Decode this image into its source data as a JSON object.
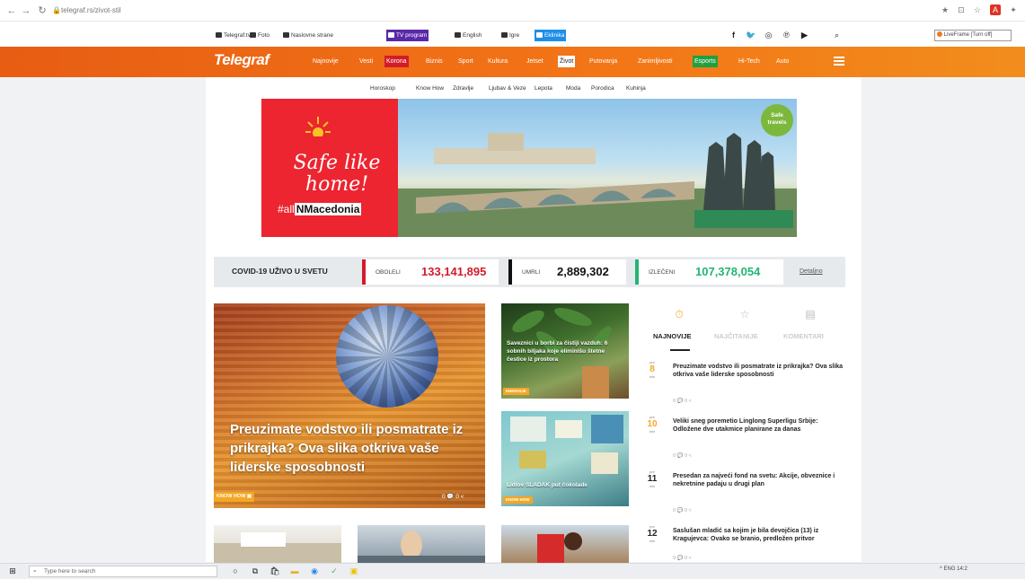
{
  "browser": {
    "url": "telegraf.rs/zivot-stil",
    "back": "←",
    "forward": "→",
    "reload": "↻"
  },
  "top_links": [
    {
      "label": "Telegraf.tv",
      "style": "plain"
    },
    {
      "label": "Foto",
      "style": "plain"
    },
    {
      "label": "Naslovne strane",
      "style": "plain"
    },
    {
      "label": "TV program",
      "style": "purple"
    },
    {
      "label": "English",
      "style": "plain"
    },
    {
      "label": "Igre",
      "style": "plain"
    },
    {
      "label": "Eklinika",
      "style": "blue"
    }
  ],
  "social": [
    "f",
    "t",
    "i",
    "p",
    "y"
  ],
  "extension": {
    "label": "LiveFrame [Turn off]"
  },
  "nav": {
    "logo": "Telegraf",
    "items": [
      {
        "label": "Najnovije",
        "style": "plain"
      },
      {
        "label": "Vesti",
        "style": "plain"
      },
      {
        "label": "Korona",
        "style": "red"
      },
      {
        "label": "Biznis",
        "style": "plain"
      },
      {
        "label": "Sport",
        "style": "plain"
      },
      {
        "label": "Kultura",
        "style": "plain"
      },
      {
        "label": "Jetset",
        "style": "plain"
      },
      {
        "label": "Život",
        "style": "white"
      },
      {
        "label": "Putovanja",
        "style": "plain"
      },
      {
        "label": "Zanimljivosti",
        "style": "plain"
      },
      {
        "label": "Esports",
        "style": "green"
      },
      {
        "label": "Hi-Tech",
        "style": "plain"
      },
      {
        "label": "Auto",
        "style": "plain"
      }
    ]
  },
  "subnav": [
    "Horoskop",
    "Know How",
    "Zdravlje",
    "Ljubav & Veze",
    "Lepota",
    "Moda",
    "Porodica",
    "Kuhinja"
  ],
  "ad": {
    "line1": "Safe like",
    "line2": "home!",
    "tag_prefix": "#all",
    "tag_bold": "NMacedonia",
    "badge1": "Safe",
    "badge2": "travels"
  },
  "covid": {
    "title": "COVID-19 UŽIVO U SVETU",
    "sick_label": "OBOLELI",
    "sick_value": "133,141,895",
    "dead_label": "UMRLI",
    "dead_value": "2,889,302",
    "healed_label": "IZLEČENI",
    "healed_value": "107,378,054",
    "details": "Detaljno",
    "colors": {
      "sick": "#d31c28",
      "dead": "#111111",
      "healed": "#22b573"
    }
  },
  "hero": {
    "title": "Preuzimate vodstvo ili posmatrate iz prikrajka? Ova slika otkriva vaše liderske sposobnosti",
    "category": "KNOW HOW",
    "meta": "0 💬 0 <"
  },
  "cards": [
    {
      "title": "Saveznici u borbi za čistiji vazduh: 6 sobnih biljaka koje eliminišu štetne čestice iz prostora",
      "category": "ENERGIJE"
    },
    {
      "title": "Lidlov SLADAK put čokolade",
      "category": "KNOW HOW"
    }
  ],
  "sidebar": {
    "tabs": [
      "NAJNOVIJE",
      "NAJČITANIJE",
      "KOMENTARI"
    ],
    "tab_icons": [
      "clock-icon",
      "star-icon",
      "comment-icon"
    ],
    "items": [
      {
        "pre": "pre",
        "num": "8",
        "unit": "min",
        "title": "Preuzimate vodstvo ili posmatrate iz prikrajka? Ova slika otkriva vaše liderske sposobnosti",
        "meta": "0 💬 0 <",
        "accent": "#f5a623"
      },
      {
        "pre": "pre",
        "num": "10",
        "unit": "min",
        "title": "Veliki sneg poremetio Linglong Superligu Srbije: Odložene dve utakmice planirane za danas",
        "meta": "0 💬 0 <",
        "accent": "#f5a623"
      },
      {
        "pre": "pre",
        "num": "11",
        "unit": "min",
        "title": "Presedan za najveći fond na svetu: Akcije, obveznice i nekretnine padaju u drugi plan",
        "meta": "0 💬 0 <",
        "accent": "#222222"
      },
      {
        "pre": "pre",
        "num": "12",
        "unit": "min",
        "title": "Saslušan mladić sa kojim je bila devojčica (13) iz Kragujevca: Ovako se branio, predložen pritvor",
        "meta": "0 💬 0 <",
        "accent": "#222222"
      }
    ]
  },
  "taskbar": {
    "search_placeholder": "Type here to search",
    "tray": "^  ENG  14:2"
  }
}
